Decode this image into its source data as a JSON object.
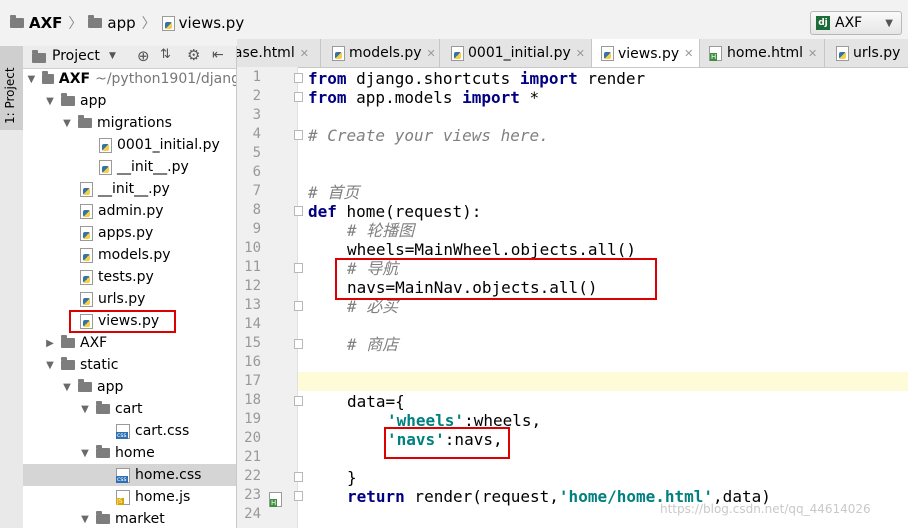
{
  "navbar": {
    "crumbs": [
      "AXF",
      "app",
      "views.py"
    ],
    "run_config": "AXF"
  },
  "toolstrip": {
    "project_tab": "1: Project"
  },
  "project_panel": {
    "header": "Project",
    "root_name": "AXF",
    "root_path": "~/python1901/djang",
    "items": [
      {
        "label": "app"
      },
      {
        "label": "migrations"
      },
      {
        "label": "0001_initial.py"
      },
      {
        "label": "__init__.py"
      },
      {
        "label": "__init__.py"
      },
      {
        "label": "admin.py"
      },
      {
        "label": "apps.py"
      },
      {
        "label": "models.py"
      },
      {
        "label": "tests.py"
      },
      {
        "label": "urls.py"
      },
      {
        "label": "views.py"
      },
      {
        "label": "AXF"
      },
      {
        "label": "static"
      },
      {
        "label": "app"
      },
      {
        "label": "cart"
      },
      {
        "label": "cart.css"
      },
      {
        "label": "home"
      },
      {
        "label": "home.css"
      },
      {
        "label": "home.js"
      },
      {
        "label": "market"
      }
    ]
  },
  "tabs": [
    {
      "label": "base.html"
    },
    {
      "label": "models.py"
    },
    {
      "label": "0001_initial.py"
    },
    {
      "label": "views.py"
    },
    {
      "label": "home.html"
    },
    {
      "label": "urls.py"
    }
  ],
  "editor": {
    "line_numbers": [
      "1",
      "2",
      "3",
      "4",
      "5",
      "6",
      "7",
      "8",
      "9",
      "10",
      "11",
      "12",
      "13",
      "14",
      "15",
      "16",
      "17",
      "18",
      "19",
      "20",
      "21",
      "22",
      "23",
      "24"
    ],
    "code": {
      "l1": {
        "kw1": "from",
        "t1": " django.shortcuts ",
        "kw2": "import",
        "t2": " render"
      },
      "l2": {
        "kw1": "from",
        "t1": " app.models ",
        "kw2": "import",
        "t2": " *"
      },
      "l4": {
        "comment": "# Create your views here."
      },
      "l7": {
        "comment": "# 首页"
      },
      "l8": {
        "kw": "def",
        "rest": " home(request):"
      },
      "l9": {
        "comment": "# 轮播图"
      },
      "l10": {
        "text": "wheels=MainWheel.objects.all()"
      },
      "l11": {
        "comment": "# 导航"
      },
      "l12": {
        "text": "navs=MainNav.objects.all()"
      },
      "l13": {
        "comment": "# 必买"
      },
      "l15": {
        "comment": "# 商店"
      },
      "l18": {
        "text": "data={"
      },
      "l19": {
        "str": "'wheels'",
        "rest": ":wheels,"
      },
      "l20": {
        "str": "'navs'",
        "rest": ":navs,"
      },
      "l22": {
        "text": "}"
      },
      "l23": {
        "kw": "return",
        "t1": " render(request,",
        "str": "'home/home.html'",
        "t2": ",data)"
      }
    }
  },
  "watermark": "https://blog.csdn.net/qq_44614026",
  "colors": {
    "highlight_box": "#dd0000",
    "keyword": "#000080",
    "string": "#008080",
    "comment": "#808080"
  }
}
